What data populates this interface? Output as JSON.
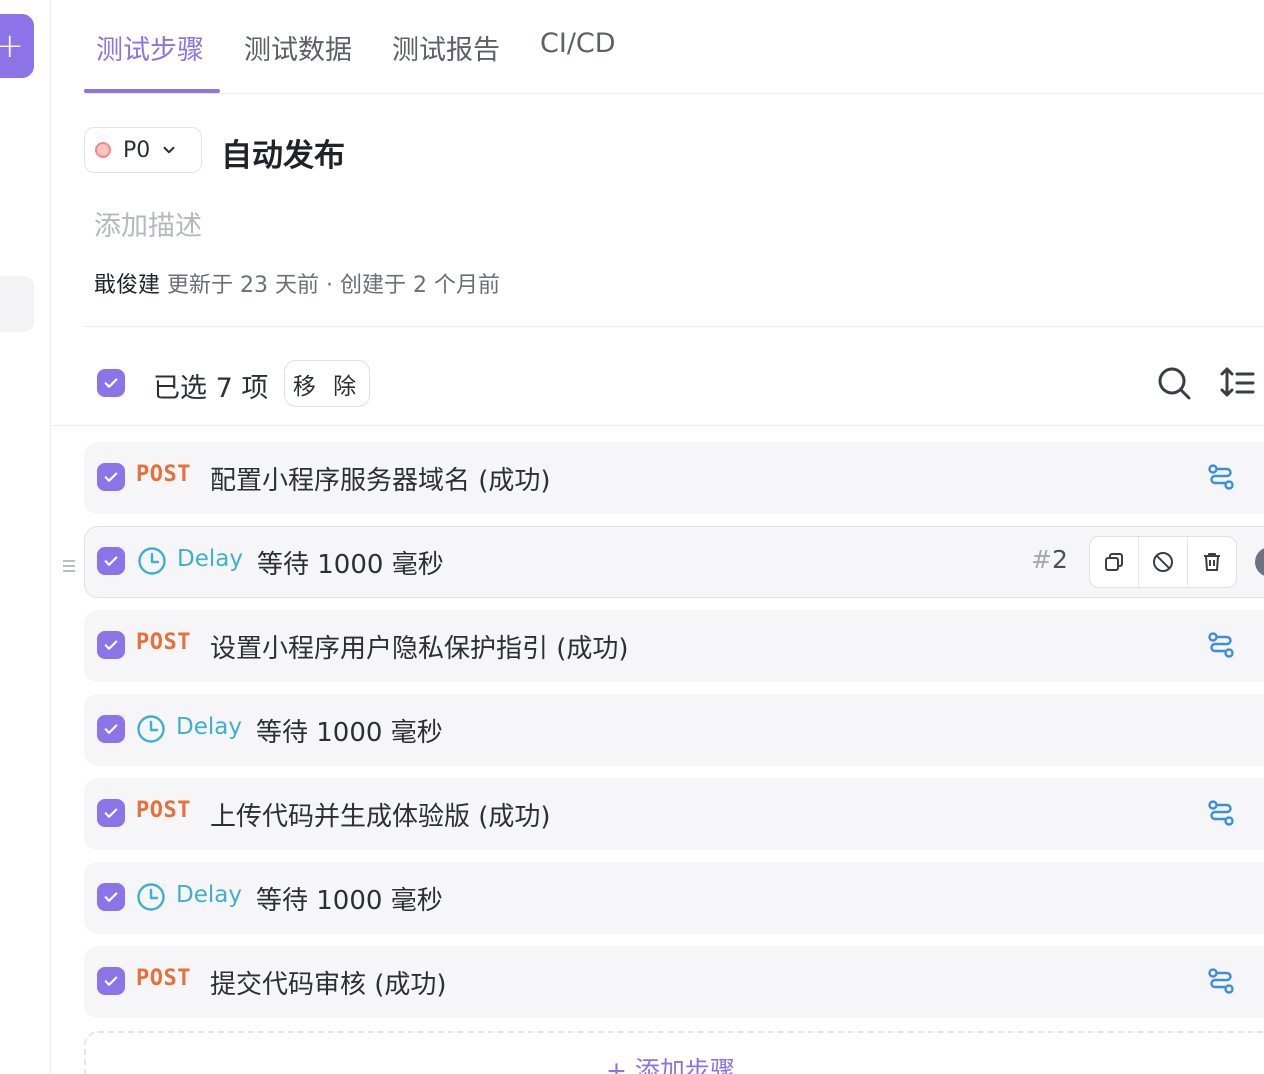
{
  "tabs": [
    {
      "label": "测试步骤"
    },
    {
      "label": "测试数据"
    },
    {
      "label": "测试报告"
    },
    {
      "label": "CI/CD"
    }
  ],
  "header": {
    "priority": "P0",
    "title": "自动发布",
    "description_placeholder": "添加描述",
    "author": "戢俊建",
    "meta_text": "更新于 23 天前 · 创建于 2 个月前"
  },
  "toolbar": {
    "selected_text": "已选 7 项",
    "remove_label": "移 除"
  },
  "steps": [
    {
      "method": "POST",
      "title": "配置小程序服务器域名 (成功)"
    },
    {
      "method": "Delay",
      "title": "等待 1000 毫秒",
      "index_hash": "#",
      "index_num": "2"
    },
    {
      "method": "POST",
      "title": "设置小程序用户隐私保护指引 (成功)"
    },
    {
      "method": "Delay",
      "title": "等待 1000 毫秒"
    },
    {
      "method": "POST",
      "title": "上传代码并生成体验版 (成功)"
    },
    {
      "method": "Delay",
      "title": "等待 1000 毫秒"
    },
    {
      "method": "POST",
      "title": "提交代码审核 (成功)"
    }
  ],
  "add_step_label": "+ 添加步骤",
  "colors": {
    "accent": "#8c74e8",
    "post": "#e8703a",
    "delay": "#3fb0d0",
    "branch": "#3b8fe0"
  },
  "icons": [
    "plus-icon",
    "chevron-down-icon",
    "check-icon",
    "search-icon",
    "sort-icon",
    "clock-icon",
    "branch-icon",
    "copy-icon",
    "disable-icon",
    "trash-icon",
    "drag-handle-icon"
  ]
}
